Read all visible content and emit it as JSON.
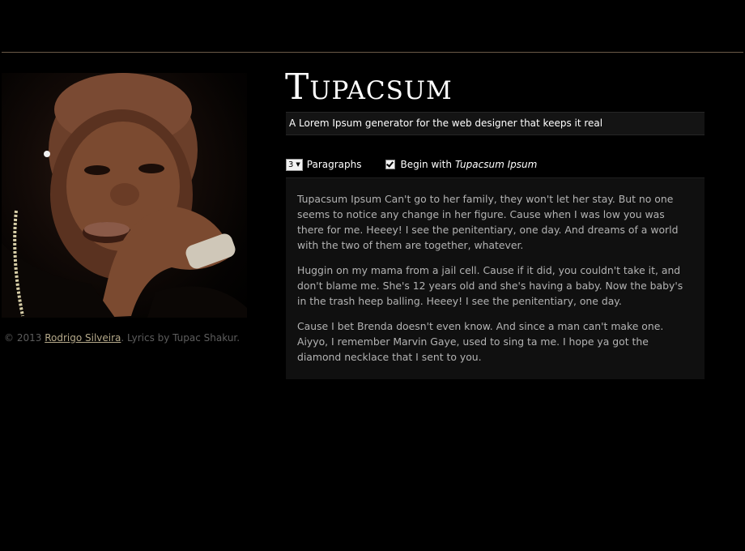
{
  "header": {
    "title": "Tupacsum",
    "subtitle": "A Lorem Ipsum generator for the web designer that keeps it real"
  },
  "controls": {
    "paragraphs_value": "3",
    "paragraphs_label": "Paragraphs",
    "begin_checked": true,
    "begin_label_prefix": "Begin with",
    "begin_label_em": "Tupacsum Ipsum"
  },
  "lyrics": {
    "paragraphs": [
      "Tupacsum Ipsum Can't go to her family, they won't let her stay. But no one seems to notice any change in her figure. Cause when I was low you was there for me. Heeey! I see the penitentiary, one day. And dreams of a world with the two of them are together, whatever.",
      "Huggin on my mama from a jail cell. Cause if it did, you couldn't take it, and don't blame me. She's 12 years old and she's having a baby. Now the baby's in the trash heep balling. Heeey! I see the penitentiary, one day.",
      "Cause I bet Brenda doesn't even know. And since a man can't make one. Aiyyo, I remember Marvin Gaye, used to sing ta me. I hope ya got the diamond necklace that I sent to you."
    ]
  },
  "footer": {
    "copyright": "© 2013",
    "author_link": "Rodrigo Silveira",
    "suffix": ". Lyrics by Tupac Shakur."
  },
  "colors": {
    "background": "#000000",
    "rule": "#6b5a48",
    "panel": "#101010",
    "link": "#b5a98a"
  }
}
